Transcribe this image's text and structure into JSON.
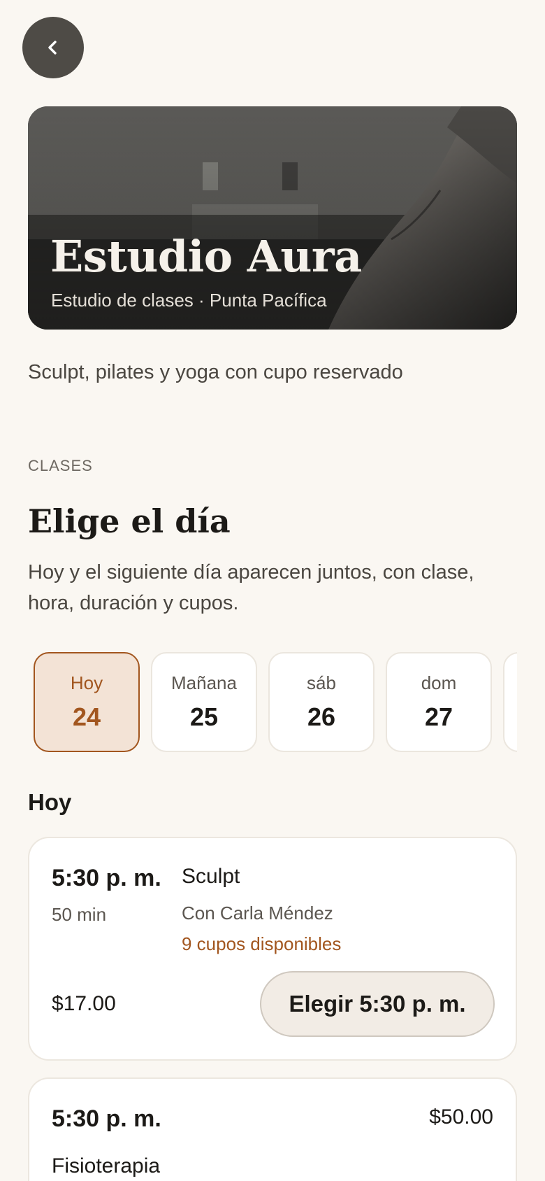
{
  "nav": {
    "back_icon": "chevron-left-icon"
  },
  "hero": {
    "title": "Estudio Aura",
    "subtitle": "Estudio de clases · Punta Pacífica",
    "image": "grayscale photo of person stretching in studio"
  },
  "tagline": "Sculpt, pilates y yoga con cupo reservado",
  "section": {
    "label": "CLASES",
    "title": "Elige el día",
    "description": "Hoy y el siguiente día aparecen juntos, con clase, hora, duración y cupos."
  },
  "days": [
    {
      "name": "Hoy",
      "number": "24",
      "selected": true
    },
    {
      "name": "Mañana",
      "number": "25",
      "selected": false
    },
    {
      "name": "sáb",
      "number": "26",
      "selected": false
    },
    {
      "name": "dom",
      "number": "27",
      "selected": false
    },
    {
      "name": "",
      "number": "",
      "selected": false
    }
  ],
  "day_heading": "Hoy",
  "classes": [
    {
      "time": "5:30 p. m.",
      "duration": "50 min",
      "name": "Sculpt",
      "instructor": "Con Carla Méndez",
      "spots": "9 cupos disponibles",
      "price": "$17.00",
      "button_label": "Elegir 5:30 p. m."
    },
    {
      "time": "5:30 p. m.",
      "price": "$50.00",
      "name": "Fisioterapia"
    }
  ],
  "colors": {
    "background": "#faf7f2",
    "accent": "#a2561f",
    "selected_day_bg": "#f3e3d6",
    "back_button": "#4e4b46"
  }
}
